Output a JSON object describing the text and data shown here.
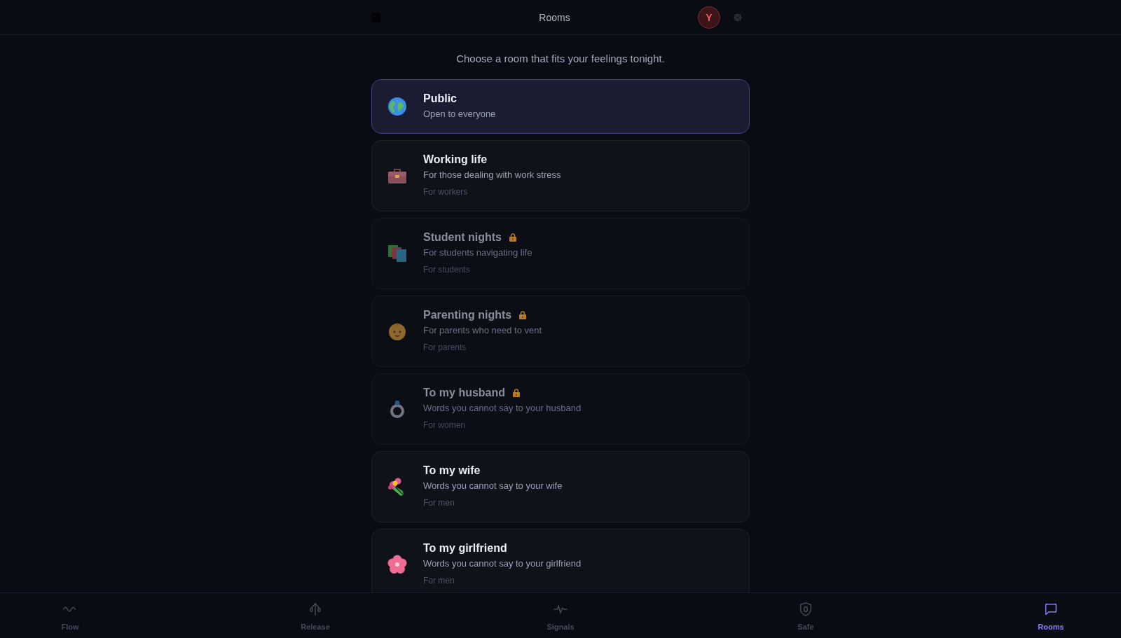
{
  "header": {
    "title": "Rooms",
    "avatar": "Y"
  },
  "prompt": "Choose a room that fits your feelings tonight.",
  "rooms": [
    {
      "name": "Public",
      "description": "Open to everyone",
      "selected": true,
      "locked": false
    },
    {
      "name": "Working life",
      "description": "For those dealing with work stress",
      "audience": "For workers",
      "selected": false,
      "locked": false
    },
    {
      "name": "Student nights",
      "description": "For students navigating life",
      "audience": "For students",
      "selected": false,
      "locked": true
    },
    {
      "name": "Parenting nights",
      "description": "For parents who need to vent",
      "audience": "For parents",
      "selected": false,
      "locked": true
    },
    {
      "name": "To my husband",
      "description": "Words you cannot say to your husband",
      "audience": "For women",
      "selected": false,
      "locked": true
    },
    {
      "name": "To my wife",
      "description": "Words you cannot say to your wife",
      "audience": "For men",
      "selected": false,
      "locked": false
    },
    {
      "name": "To my girlfriend",
      "description": "Words you cannot say to your girlfriend",
      "audience": "For men",
      "selected": false,
      "locked": false
    }
  ],
  "nav": [
    {
      "label": "Flow",
      "selected": false
    },
    {
      "label": "Release",
      "selected": false
    },
    {
      "label": "Signals",
      "selected": false
    },
    {
      "label": "Safe",
      "selected": false
    },
    {
      "label": "Rooms",
      "selected": true
    }
  ]
}
